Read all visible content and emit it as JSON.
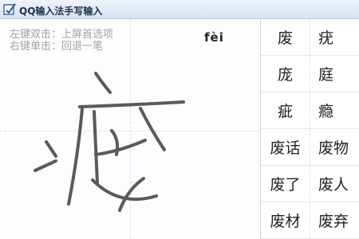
{
  "window": {
    "title": "QQ输入法手写输入",
    "icon": "pen-checkbox-icon"
  },
  "hints": {
    "line1": "左键双击：上屏首选项",
    "line2": "右键单击：回退一笔"
  },
  "pinyin": "fèi",
  "candidates": [
    [
      "废",
      "疣"
    ],
    [
      "庞",
      "庭"
    ],
    [
      "疵",
      "瘾"
    ],
    [
      "废话",
      "废物"
    ],
    [
      "废了",
      "废人"
    ],
    [
      "废材",
      "废弃"
    ]
  ],
  "colors": {
    "ink": "#5a5a5a",
    "title_gradient_top": "#eef3fb",
    "title_gradient_bottom": "#d9e3f2"
  }
}
